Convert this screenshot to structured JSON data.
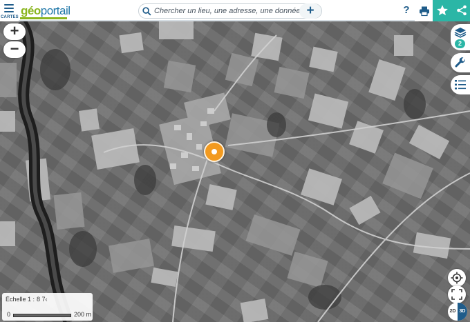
{
  "header": {
    "menu_label": "CARTES",
    "logo_geo": "géo",
    "logo_portail": "portail",
    "search_placeholder": "Chercher un lieu, une adresse, une donnée",
    "help_label": "?"
  },
  "layers": {
    "count": "2"
  },
  "zoom": {
    "in_label": "+",
    "out_label": "−"
  },
  "scale": {
    "label": "Échelle 1 :",
    "value": "8 7‹",
    "start": "0",
    "distance": "200 m"
  },
  "view_mode": {
    "label_2d": "2D",
    "label_3d": "3D"
  },
  "colors": {
    "brand_green": "#8ab51e",
    "brand_blue": "#1f77a8",
    "accent_teal": "#2bb6a6",
    "marker_orange": "#f29a1f"
  }
}
